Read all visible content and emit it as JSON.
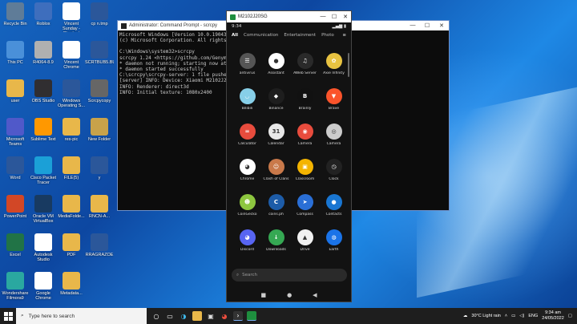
{
  "desktop": {
    "icons": [
      {
        "label": "Recycle Bin",
        "color": "#5f7c98"
      },
      {
        "label": "Roblox",
        "color": "#3e6ebd"
      },
      {
        "label": "Vincent Sunday - Shortcut",
        "color": "#ffffff"
      },
      {
        "label": "cp n.tmp",
        "color": "#2b579a"
      },
      {
        "label": "This PC",
        "color": "#4a90d9"
      },
      {
        "label": "R4064-8.9",
        "color": "#b0b0b0"
      },
      {
        "label": "Vincent Chrome",
        "color": "#ffffff"
      },
      {
        "label": "SCRTBUB5.BU",
        "color": "#2b579a"
      },
      {
        "label": "user",
        "color": "#e8b74a"
      },
      {
        "label": "OBS Studio",
        "color": "#302e31"
      },
      {
        "label": "Windows Operating S...",
        "color": "#2b579a"
      },
      {
        "label": "Scrcpycopy",
        "color": "#666666"
      },
      {
        "label": "Microsoft Teams",
        "color": "#5059c9"
      },
      {
        "label": "Sublime Text",
        "color": "#ff9800"
      },
      {
        "label": "res-pic",
        "color": "#e8b74a"
      },
      {
        "label": "New Folder",
        "color": "#c8a24a"
      },
      {
        "label": "Word",
        "color": "#2b579a"
      },
      {
        "label": "Cisco Packet Tracer",
        "color": "#1ba0d7"
      },
      {
        "label": "FILE(5)",
        "color": "#e8b74a"
      },
      {
        "label": "y",
        "color": "#2b579a"
      },
      {
        "label": "PowerPoint",
        "color": "#d24726"
      },
      {
        "label": "Oracle VM VirtualBox",
        "color": "#183a61"
      },
      {
        "label": "MediaFolde...",
        "color": "#e8b74a"
      },
      {
        "label": "RNCN-A...",
        "color": "#e8b74a"
      },
      {
        "label": "Excel",
        "color": "#217346"
      },
      {
        "label": "Autodesk Studio",
        "color": "#ffffff"
      },
      {
        "label": "PDF",
        "color": "#e8b74a"
      },
      {
        "label": "RRAGRAZOE",
        "color": "#2b579a"
      },
      {
        "label": "Wondershare Filmora9",
        "color": "#2aa8a0"
      },
      {
        "label": "Google Chrome",
        "color": "#ffffff"
      },
      {
        "label": "Metadata...",
        "color": "#e8b74a"
      }
    ]
  },
  "cmd": {
    "title": "Administrator: Command Prompt - scrcpy",
    "lines": [
      "Microsoft Windows [Version 10.0.19043.1",
      "(c) Microsoft Corporation. All rights re",
      "",
      "C:\\Windows\\system32>scrcpy",
      "scrcpy 1.24 <https://github.com/Genymobi",
      "* daemon not running; starting now at tc",
      "* daemon started successfully",
      "C:\\scrcpy\\scrcpy-server: 1 file pushed,",
      "[server] INFO: Device: Xiaomi M2102J20SC",
      "INFO: Renderer: direct3d",
      "INFO: Initial texture: 1080x2400"
    ]
  },
  "phone": {
    "title": "M2102J20SG",
    "time": "9:34",
    "status_right": "▂▄▆ ▮",
    "tabs": [
      "All",
      "Communication",
      "Entertainment",
      "Photo"
    ],
    "apps": [
      {
        "label": "antivirus",
        "color": "#555555",
        "glyph": "☰"
      },
      {
        "label": "Assistant",
        "color": "#ffffff",
        "glyph": "●"
      },
      {
        "label": "AWeb Server",
        "color": "#2a2a2a",
        "glyph": "♫"
      },
      {
        "label": "Axie Infinity",
        "color": "#e8c341",
        "glyph": "✿"
      },
      {
        "label": "Bilibili",
        "color": "#87cfe8",
        "glyph": "◡"
      },
      {
        "label": "Binance",
        "color": "#1e1e1e",
        "glyph": "◆"
      },
      {
        "label": "Brainly",
        "color": "#111111",
        "glyph": "B"
      },
      {
        "label": "Brave",
        "color": "#fb542b",
        "glyph": "▼"
      },
      {
        "label": "Calculator",
        "color": "#e84c3d",
        "glyph": "="
      },
      {
        "label": "Calendar",
        "color": "#e8e8e8",
        "glyph": "31"
      },
      {
        "label": "Camera",
        "color": "#e84c3d",
        "glyph": "◉"
      },
      {
        "label": "Camera",
        "color": "#cccccc",
        "glyph": "◎"
      },
      {
        "label": "Chrome",
        "color": "#ffffff",
        "glyph": "◕"
      },
      {
        "label": "Clash of Clans",
        "color": "#c9794a",
        "glyph": "☺"
      },
      {
        "label": "Classroom",
        "color": "#f4b400",
        "glyph": "▣"
      },
      {
        "label": "Clock",
        "color": "#222222",
        "glyph": "◷"
      },
      {
        "label": "CoinGecko",
        "color": "#8dc63f",
        "glyph": "☻"
      },
      {
        "label": "coins.ph",
        "color": "#1d5ca8",
        "glyph": "C"
      },
      {
        "label": "Compass",
        "color": "#2a6fd6",
        "glyph": "➤"
      },
      {
        "label": "Contacts",
        "color": "#1976d2",
        "glyph": "●"
      },
      {
        "label": "Discord",
        "color": "#5865f2",
        "glyph": "◕"
      },
      {
        "label": "Downloads",
        "color": "#35a853",
        "glyph": "↓"
      },
      {
        "label": "Drive",
        "color": "#f1f1f1",
        "glyph": "▲"
      },
      {
        "label": "Earth",
        "color": "#1a73e8",
        "glyph": "◍"
      }
    ],
    "search_placeholder": "Search"
  },
  "taskbar": {
    "search_placeholder": "Type here to search",
    "weather": "30°C  Light rain",
    "lang": "ENG",
    "time": "9:34 am",
    "date": "24/05/2022"
  }
}
